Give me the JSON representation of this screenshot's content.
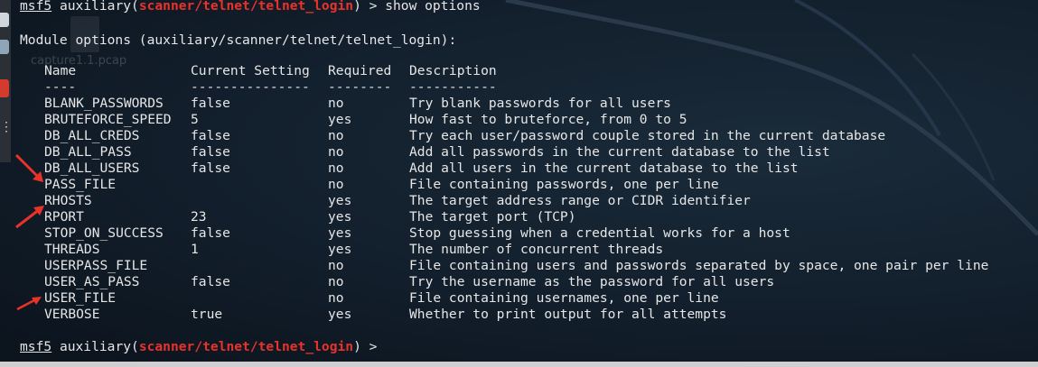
{
  "prompt": {
    "host": "msf5",
    "module_word": "auxiliary",
    "open_paren": "(",
    "module_path": "scanner/telnet/telnet_login",
    "close_paren": ")",
    "arrow": " > ",
    "command": "show options"
  },
  "module_options_title": "Module options (auxiliary/scanner/telnet/telnet_login):",
  "columns": {
    "name": "Name",
    "setting": "Current Setting",
    "required": "Required",
    "description": "Description"
  },
  "separators": {
    "name": "----",
    "setting": "---------------",
    "required": "--------",
    "description": "-----------"
  },
  "options": [
    {
      "name": "BLANK_PASSWORDS",
      "setting": "false",
      "required": "no",
      "description": "Try blank passwords for all users"
    },
    {
      "name": "BRUTEFORCE_SPEED",
      "setting": "5",
      "required": "yes",
      "description": "How fast to bruteforce, from 0 to 5"
    },
    {
      "name": "DB_ALL_CREDS",
      "setting": "false",
      "required": "no",
      "description": "Try each user/password couple stored in the current database"
    },
    {
      "name": "DB_ALL_PASS",
      "setting": "false",
      "required": "no",
      "description": "Add all passwords in the current database to the list"
    },
    {
      "name": "DB_ALL_USERS",
      "setting": "false",
      "required": "no",
      "description": "Add all users in the current database to the list"
    },
    {
      "name": "PASS_FILE",
      "setting": "",
      "required": "no",
      "description": "File containing passwords, one per line"
    },
    {
      "name": "RHOSTS",
      "setting": "",
      "required": "yes",
      "description": "The target address range or CIDR identifier"
    },
    {
      "name": "RPORT",
      "setting": "23",
      "required": "yes",
      "description": "The target port (TCP)"
    },
    {
      "name": "STOP_ON_SUCCESS",
      "setting": "false",
      "required": "yes",
      "description": "Stop guessing when a credential works for a host"
    },
    {
      "name": "THREADS",
      "setting": "1",
      "required": "yes",
      "description": "The number of concurrent threads"
    },
    {
      "name": "USERPASS_FILE",
      "setting": "",
      "required": "no",
      "description": "File containing users and passwords separated by space, one pair per line"
    },
    {
      "name": "USER_AS_PASS",
      "setting": "false",
      "required": "no",
      "description": "Try the username as the password for all users"
    },
    {
      "name": "USER_FILE",
      "setting": "",
      "required": "no",
      "description": "File containing usernames, one per line"
    },
    {
      "name": "VERBOSE",
      "setting": "true",
      "required": "yes",
      "description": "Whether to print output for all attempts"
    }
  ],
  "desktop_ghost_label": "capture1.1.pcap",
  "colors": {
    "prompt_path": "#e8322a",
    "annotation_arrow": "#e8322a",
    "terminal_text": "#e6e6e6",
    "terminal_bg": "#121e2b"
  },
  "icons": [
    "terminal-prompt-icon",
    "annotation-arrow-icon",
    "dock-icon"
  ]
}
